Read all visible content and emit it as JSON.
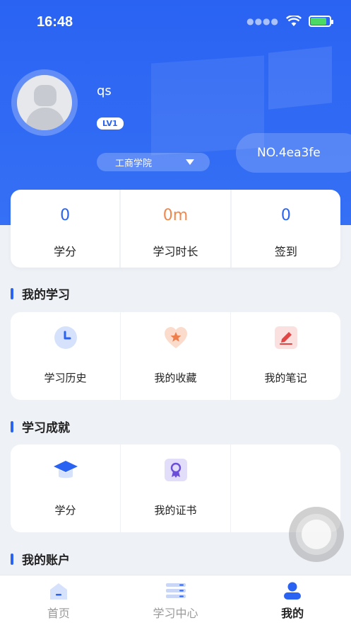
{
  "status": {
    "time": "16:48"
  },
  "profile": {
    "username": "qs",
    "level": "LV1",
    "college": "工商学院",
    "id_badge": "NO.4ea3fe"
  },
  "stats": [
    {
      "value": "0",
      "label": "学分"
    },
    {
      "value": "0m",
      "label": "学习时长"
    },
    {
      "value": "0",
      "label": "签到"
    }
  ],
  "my_learning": {
    "title": "我的学习",
    "items": [
      {
        "label": "学习历史",
        "icon": "clock-icon"
      },
      {
        "label": "我的收藏",
        "icon": "heart-star-icon"
      },
      {
        "label": "我的笔记",
        "icon": "pencil-icon"
      }
    ]
  },
  "achievements": {
    "title": "学习成就",
    "items": [
      {
        "label": "学分",
        "icon": "graduation-cap-icon"
      },
      {
        "label": "我的证书",
        "icon": "certificate-icon"
      }
    ]
  },
  "account": {
    "title": "我的账户"
  },
  "tabbar": [
    {
      "label": "首页",
      "icon": "home-icon"
    },
    {
      "label": "学习中心",
      "icon": "list-icon"
    },
    {
      "label": "我的",
      "icon": "user-icon"
    }
  ],
  "colors": {
    "primary": "#2a63f2",
    "accent_orange": "#f0884c",
    "background": "#eef1f6"
  }
}
